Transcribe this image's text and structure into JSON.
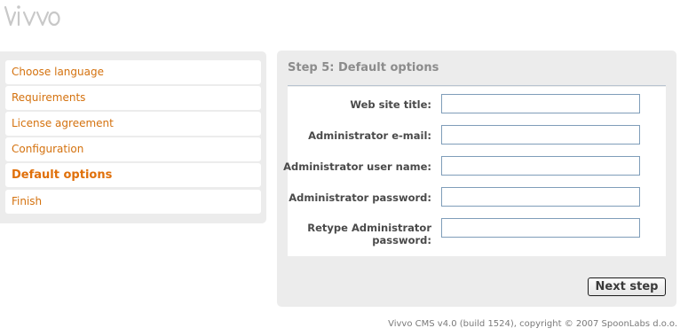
{
  "logo": {
    "text": "vivvo"
  },
  "steps": [
    {
      "label": "Choose language",
      "active": false
    },
    {
      "label": "Requirements",
      "active": false
    },
    {
      "label": "License agreement",
      "active": false
    },
    {
      "label": "Configuration",
      "active": false
    },
    {
      "label": "Default options",
      "active": true
    },
    {
      "label": "Finish",
      "active": false
    }
  ],
  "panel": {
    "title": "Step 5: Default options",
    "fields": [
      {
        "label": "Web site title:",
        "value": ""
      },
      {
        "label": "Administrator e-mail:",
        "value": ""
      },
      {
        "label": "Administrator user name:",
        "value": ""
      },
      {
        "label": "Administrator password:",
        "value": ""
      },
      {
        "label": "Retype Administrator password:",
        "value": ""
      }
    ],
    "next_label": "Next step"
  },
  "footer": {
    "text": "Vivvo CMS v4.0 (build 1524), copyright © 2007 SpoonLabs d.o.o."
  },
  "colors": {
    "accent_orange": "#e0700a",
    "panel_bg": "#ececec",
    "input_border": "#7f9db9",
    "logo_gray": "#c8c8c8"
  }
}
